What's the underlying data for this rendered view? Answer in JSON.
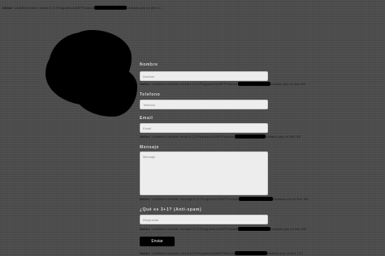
{
  "notice_top": {
    "prefix": "Notice",
    "text": ": Undefined index: enviar in D:\\Programs\\XAMPP\\htdocs\\",
    "suffix": "contacto.php on line 14"
  },
  "form": {
    "nombre": {
      "label": "Nombre",
      "placeholder": "Nombre"
    },
    "telefono": {
      "label": "Telefono",
      "placeholder": "Telefono"
    },
    "email": {
      "label": "Email",
      "placeholder": "Email"
    },
    "mensaje": {
      "label": "Mensaje",
      "placeholder": "Mensaje"
    },
    "captcha": {
      "label": "¿Qué es 3+1? (Anti-spam)",
      "placeholder": "Respuesta"
    },
    "submit_label": "Enviar"
  },
  "notices": {
    "n1": {
      "prefix": "Notice",
      "text": ": Undefined variable: nombre in D:\\Programs\\XAMPP\\htdocs\\",
      "suffix": "contacto.php on line 153"
    },
    "n2": {
      "prefix": "Notice",
      "text": ": Undefined variable: email in D:\\Programs\\XAMPP\\htdocs\\",
      "suffix": "contacto.php on line 160"
    },
    "n3": {
      "prefix": "Notice",
      "text": ": Undefined variable: mensaje in D:\\Programs\\XAMPP\\htdocs\\",
      "suffix": "contacto.php on line 164"
    },
    "n4": {
      "prefix": "Notice",
      "text": ": Undefined variable: humano in D:\\Programs\\XAMPP\\htdocs\\",
      "suffix": "contacto.php on line 168"
    },
    "n5": {
      "prefix": "Notice",
      "text": ": Undefined variable: result in D:\\Programs\\XAMPP\\htdocs\\",
      "suffix": "contacto.php on line 171"
    }
  }
}
